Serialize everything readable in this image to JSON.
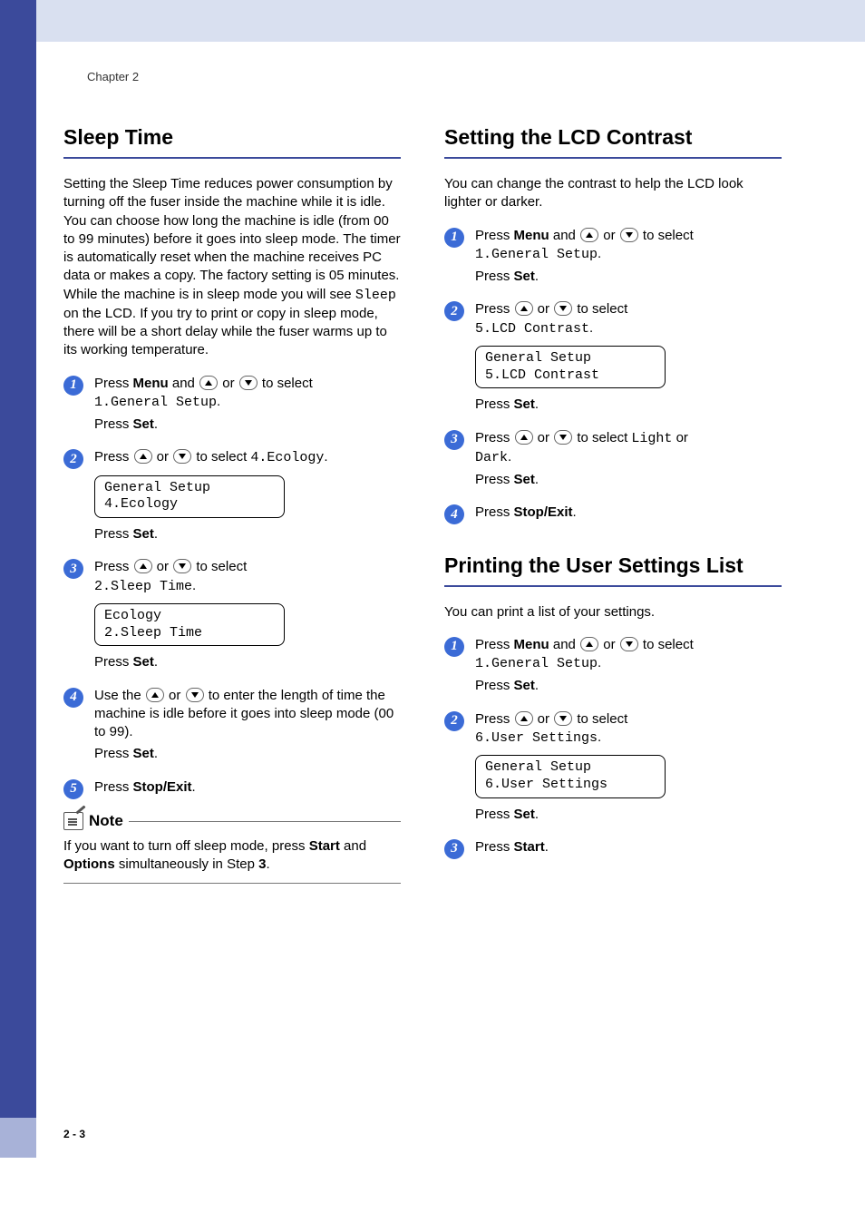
{
  "chapter": "Chapter 2",
  "footer": "2 - 3",
  "left": {
    "heading": "Sleep Time",
    "intro": "Setting the Sleep Time reduces power consumption by turning off the fuser inside the machine while it is idle. You can choose how long the machine is idle (from 00 to 99 minutes) before it goes into sleep mode. The timer is automatically reset when the machine receives PC data or makes a copy. The factory setting is 05 minutes. While the machine is in sleep mode you will see ",
    "intro_mono": "Sleep",
    "intro_tail": " on the LCD. If you try to print or copy in sleep mode, there will be a short delay while the fuser warms up to its working temperature.",
    "step1_a": "Press ",
    "step1_menu": "Menu",
    "step1_b": " and ",
    "step1_c": " or ",
    "step1_d": " to select ",
    "step1_mono": "1.General Setup",
    "step1_e": ".",
    "press_set": "Press ",
    "set_label": "Set",
    "period": ".",
    "step2_a": "Press ",
    "step2_b": " or ",
    "step2_c": " to select ",
    "step2_mono": "4.Ecology",
    "step2_d": ".",
    "lcd2_l1": "General Setup",
    "lcd2_l2": "4.Ecology",
    "step3_a": "Press ",
    "step3_b": " or ",
    "step3_c": " to select ",
    "step3_mono": "2.Sleep Time",
    "step3_d": ".",
    "lcd3_l1": "Ecology",
    "lcd3_l2": "2.Sleep Time",
    "step4_a": "Use the ",
    "step4_b": " or ",
    "step4_c": " to enter the length of time the machine is idle before it goes into sleep mode (00 to 99).",
    "step5_a": "Press ",
    "stop_exit": "Stop/Exit",
    "note_label": "Note",
    "note_a": "If you want to turn off sleep mode, press ",
    "note_start": "Start",
    "note_b": " and ",
    "note_options": "Options",
    "note_c": " simultaneously in Step ",
    "note_step": "3",
    "note_d": "."
  },
  "right": {
    "heading1": "Setting the LCD Contrast",
    "intro1": "You can change the contrast to help the LCD look lighter or darker.",
    "c1_step1_a": "Press ",
    "c1_step1_menu": "Menu",
    "c1_step1_b": " and ",
    "c1_step1_c": " or ",
    "c1_step1_d": " to select ",
    "c1_step1_mono": "1.General Setup",
    "c1_step1_e": ".",
    "c1_step2_a": "Press ",
    "c1_step2_b": " or ",
    "c1_step2_c": " to select ",
    "c1_step2_mono": "5.LCD Contrast",
    "c1_step2_d": ".",
    "c1_lcd_l1": "General Setup",
    "c1_lcd_l2": "5.LCD Contrast",
    "c1_step3_a": "Press ",
    "c1_step3_b": " or ",
    "c1_step3_c": " to select ",
    "c1_step3_light": "Light",
    "c1_step3_or": " or ",
    "c1_step3_dark": "Dark",
    "c1_step3_d": ".",
    "c1_step4_a": "Press ",
    "heading2": "Printing the User Settings List",
    "intro2": "You can print a list of your settings.",
    "c2_step1_a": "Press ",
    "c2_step1_menu": "Menu",
    "c2_step1_b": " and ",
    "c2_step1_c": " or ",
    "c2_step1_d": " to select ",
    "c2_step1_mono": "1.General Setup",
    "c2_step1_e": ".",
    "c2_step2_a": "Press ",
    "c2_step2_b": " or ",
    "c2_step2_c": " to select ",
    "c2_step2_mono": "6.User Settings",
    "c2_step2_d": ".",
    "c2_lcd_l1": "General Setup",
    "c2_lcd_l2": "6.User Settings",
    "c2_step3_a": "Press ",
    "start_label": "Start"
  }
}
